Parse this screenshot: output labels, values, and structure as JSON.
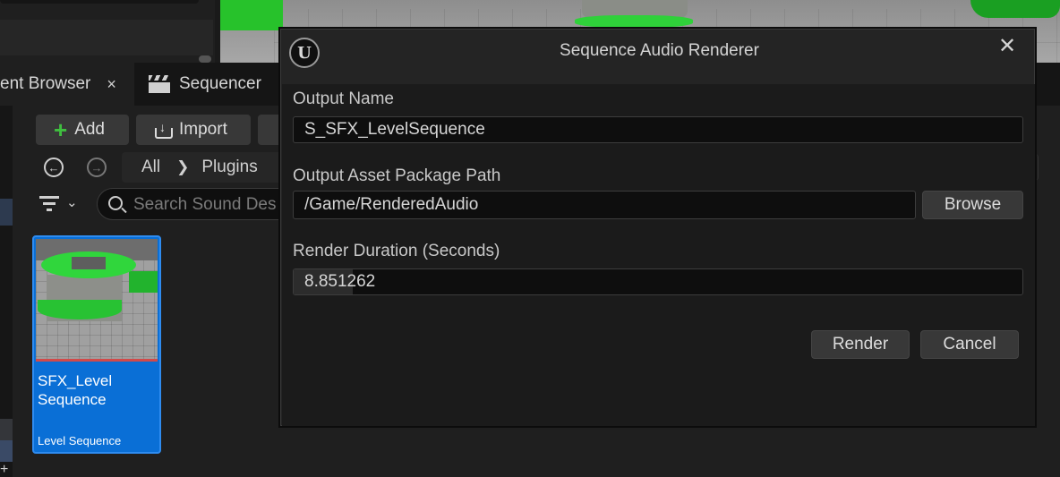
{
  "content_browser": {
    "tab_label": "ent Browser",
    "tab_close": "×",
    "add_label": "Add",
    "import_label": "Import",
    "path": [
      "All",
      "Plugins"
    ],
    "search_placeholder": "Search Sound Des",
    "asset": {
      "name": "SFX_Level Sequence",
      "type": "Level Sequence"
    },
    "plus_glyph": "+"
  },
  "sequencer_tab": {
    "label": "Sequencer"
  },
  "dialog": {
    "title": "Sequence Audio Renderer",
    "logo": "U",
    "close_glyph": "✕",
    "output_name": {
      "label": "Output Name",
      "value": "S_SFX_LevelSequence"
    },
    "package_path": {
      "label": "Output Asset Package Path",
      "value": "/Game/RenderedAudio",
      "browse_label": "Browse"
    },
    "duration": {
      "label": "Render Duration (Seconds)",
      "value": "8.851262"
    },
    "render_label": "Render",
    "cancel_label": "Cancel"
  },
  "colors": {
    "selection_blue": "#0a6fd6",
    "add_green": "#3fbf3f",
    "dialog_bg": "#242424"
  }
}
